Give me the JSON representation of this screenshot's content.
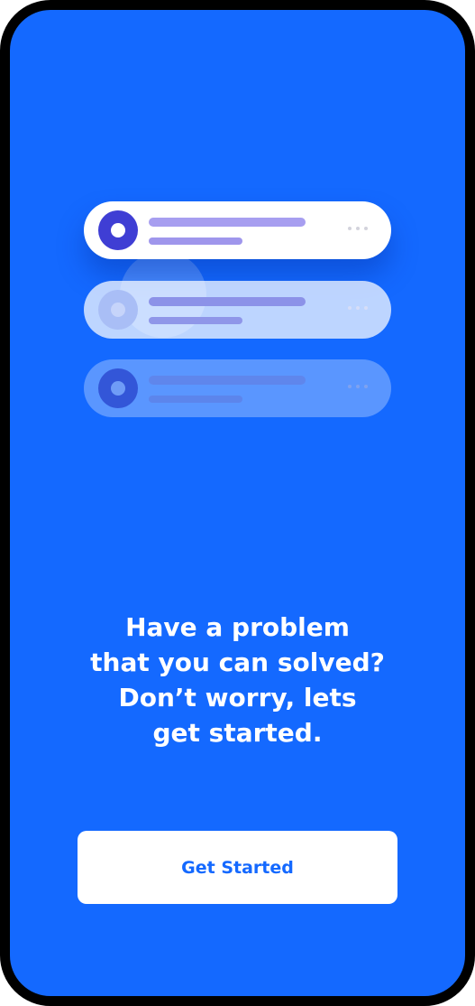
{
  "onboarding": {
    "headline_lines": [
      "Have a problem",
      "that you can solved?",
      "Don’t worry, lets",
      "get started."
    ],
    "cta_label": "Get Started"
  },
  "illustration": {
    "cards": [
      {
        "state": "active",
        "icon": "target-icon"
      },
      {
        "state": "faded",
        "icon": "target-icon"
      },
      {
        "state": "faded",
        "icon": "target-icon"
      }
    ]
  },
  "colors": {
    "background": "#1469FF",
    "frame": "#000000",
    "button_background": "#FFFFFF",
    "button_text": "#1469FF",
    "headline_text": "#FFFFFF",
    "avatar_accent": "#3F3ED4"
  }
}
